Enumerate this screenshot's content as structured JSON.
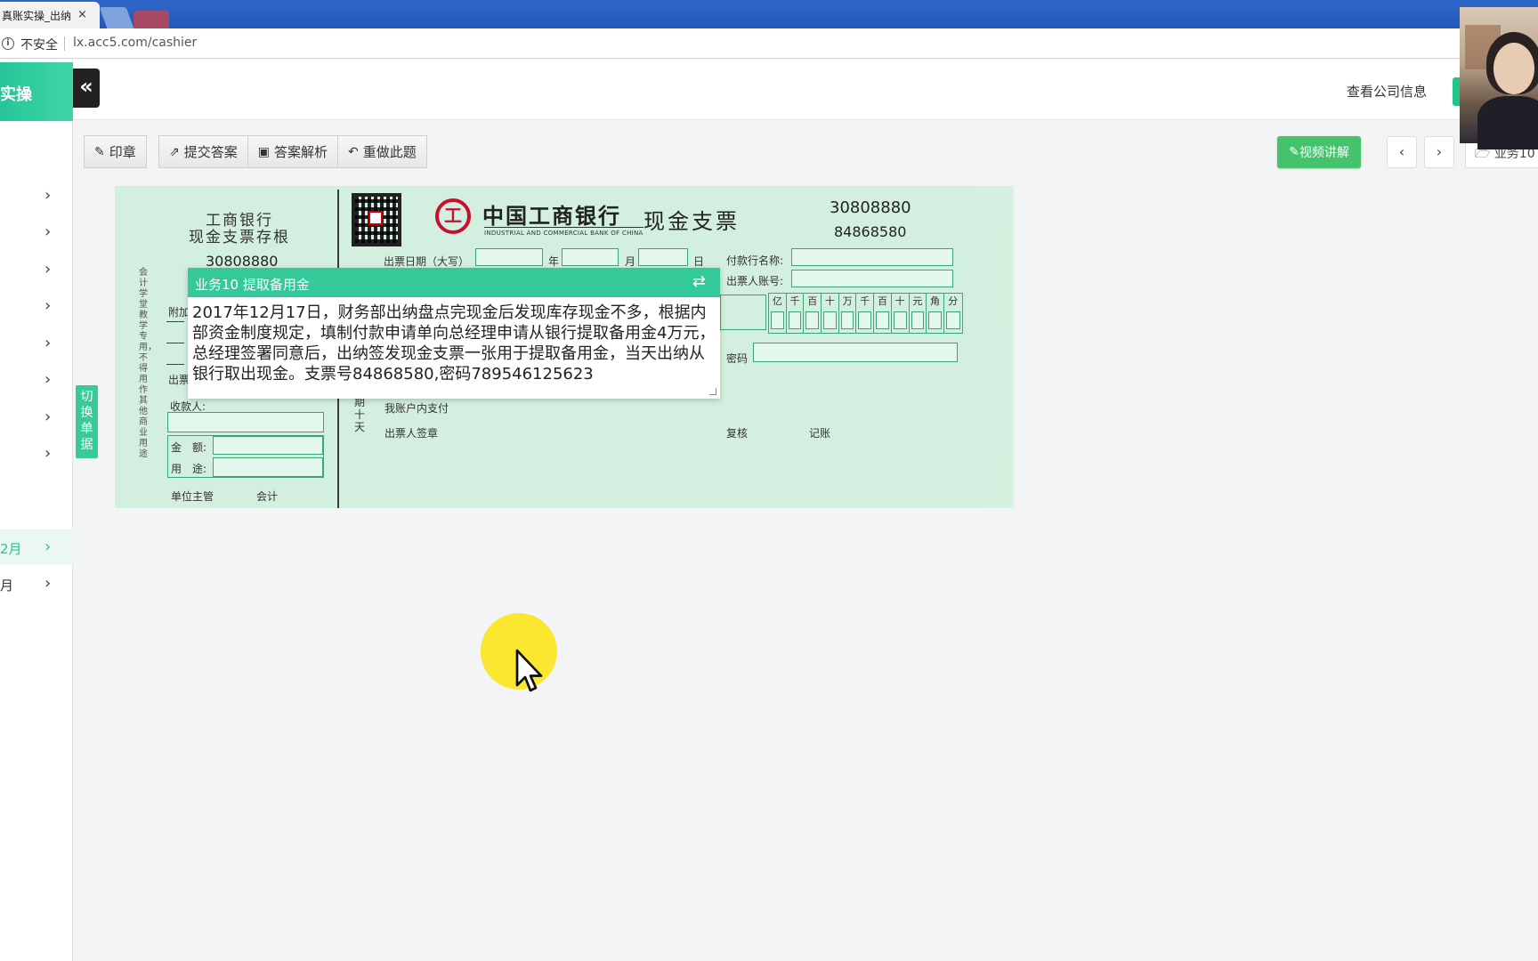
{
  "browser": {
    "tab_title": "真账实操_出纳",
    "tab_close": "×",
    "security_label": "不安全",
    "url": "lx.acc5.com/cashier"
  },
  "header": {
    "brand": "实操",
    "collapse_icon": "«",
    "company_link": "查看公司信息"
  },
  "sidebar": {
    "items": [
      {
        "label": "",
        "chevron": "›"
      },
      {
        "label": "",
        "chevron": "›"
      },
      {
        "label": "",
        "chevron": "›"
      },
      {
        "label": "",
        "chevron": "›"
      },
      {
        "label": "",
        "chevron": "›"
      },
      {
        "label": "",
        "chevron": "›"
      },
      {
        "label": "",
        "chevron": "›"
      },
      {
        "label": "",
        "chevron": "›"
      },
      {
        "label": "2月",
        "chevron": "›"
      },
      {
        "label": "月",
        "chevron": "›"
      }
    ]
  },
  "toolbar": {
    "seal": "印章",
    "submit": "提交答案",
    "analysis": "答案解析",
    "redo": "重做此题",
    "video": "视频讲解",
    "prev": "‹",
    "next": "›",
    "task_select": "业务10"
  },
  "switch_doc": "切换单据",
  "cheque": {
    "stub_title": "工商银行\n现金支票存根",
    "stub_number": "30808880",
    "stub_side_note": "会计学堂教学专用，不得用作其他商业用途",
    "stub_fields": {
      "attach": "附加",
      "issue_date": "出票",
      "payee": "收款人:",
      "amount": "金　额:",
      "purpose": "用　途:",
      "supervisor": "单位主管",
      "accountant": "会计"
    },
    "bank_name": "中国工商银行",
    "bank_name_en": "INDUSTRIAL AND COMMERCIAL BANK OF CHINA",
    "type": "现金支票",
    "number1": "30808880",
    "number2": "84868580",
    "issue_date_label": "出票日期（大写）",
    "year": "年",
    "month": "月",
    "day": "日",
    "payer_bank_label": "付款行名称:",
    "payer_account_label": "出票人账号:",
    "amount_units": [
      "亿",
      "千",
      "百",
      "十",
      "万",
      "千",
      "百",
      "十",
      "元",
      "角",
      "分"
    ],
    "password_label": "密码",
    "period_label": "期\n十\n天",
    "pay_from": "我账户内支付",
    "drawer_signature": "出票人签章",
    "review": "复核",
    "bookkeeping": "记账"
  },
  "task": {
    "title": "业务10 提取备用金",
    "swap_icon": "⇄",
    "description": "2017年12月17日，财务部出纳盘点完现金后发现库存现金不多，根据内部资金制度规定，填制付款申请单向总经理申请从银行提取备用金4万元，总经理签署同意后，出纳签发现金支票一张用于提取备用金，当天出纳从银行取出现金。支票号84868580,密码789546125623"
  },
  "colors": {
    "brand_green": "#25c597",
    "video_green": "#45c26c",
    "cheque_bg": "#d2efdf",
    "cursor_halo": "#fbe630"
  }
}
